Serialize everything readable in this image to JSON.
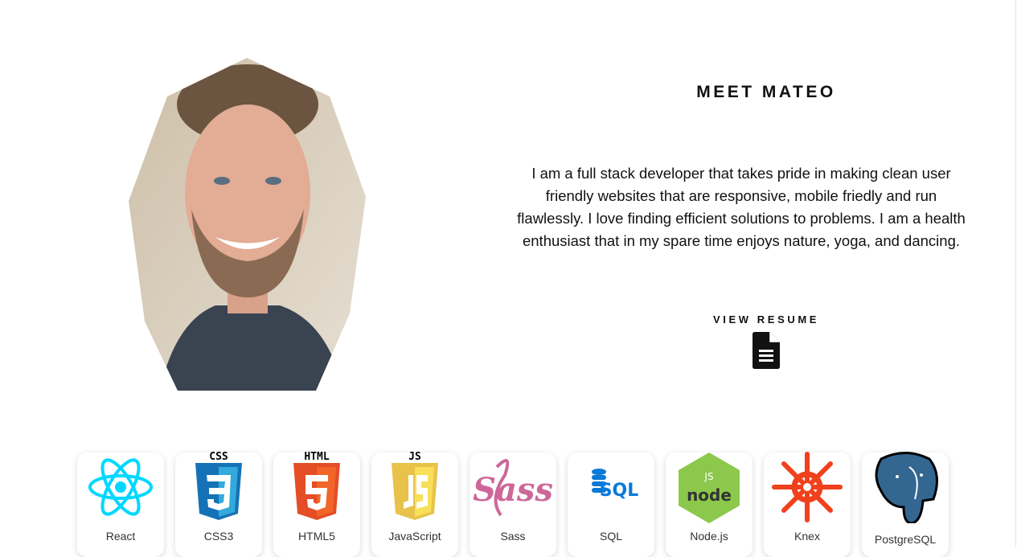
{
  "about": {
    "title": "MEET MATEO",
    "bio": "I am a full stack developer that takes pride in making clean user friendly websites that are responsive, mobile friedly and run flawlessly. I love finding efficient solutions to problems. I am a health enthusiast that in my spare time enjoys nature, yoga, and dancing.",
    "resume_label": "VIEW RESUME",
    "resume_icon": "document-icon"
  },
  "skills": [
    {
      "name": "React",
      "icon": "react-icon"
    },
    {
      "name": "CSS3",
      "icon": "css3-icon"
    },
    {
      "name": "HTML5",
      "icon": "html5-icon"
    },
    {
      "name": "JavaScript",
      "icon": "javascript-icon"
    },
    {
      "name": "Sass",
      "icon": "sass-icon"
    },
    {
      "name": "SQL",
      "icon": "sql-icon"
    },
    {
      "name": "Node.js",
      "icon": "nodejs-icon"
    },
    {
      "name": "Knex",
      "icon": "knex-icon"
    },
    {
      "name": "PostgreSQL",
      "icon": "postgresql-icon"
    }
  ],
  "colors": {
    "react": "#00d8ff",
    "css": "#1572b6",
    "html": "#e44d26",
    "js": "#e8c24a",
    "sass": "#cd6799",
    "sql": "#0a7ad9",
    "node": "#8cc84b",
    "knex": "#f0401c",
    "pg": "#336791"
  }
}
